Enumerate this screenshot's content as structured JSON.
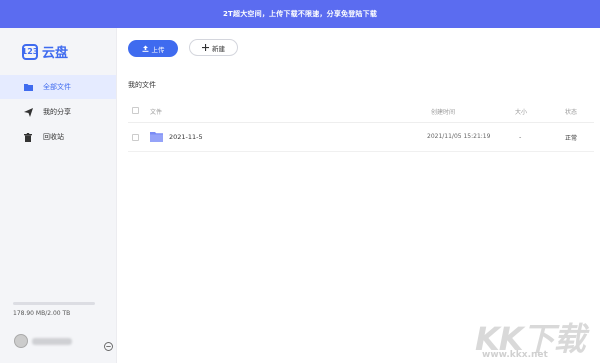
{
  "banner": {
    "text": "2T超大空间，上传下载不限速，分享免登陆下载"
  },
  "brand": {
    "logo_mark": "123",
    "name": "云盘",
    "color": "#3f6bef"
  },
  "sidebar": {
    "items": [
      {
        "label": "全部文件",
        "icon": "folder-icon",
        "active": true
      },
      {
        "label": "我的分享",
        "icon": "send-icon",
        "active": false
      },
      {
        "label": "回收站",
        "icon": "trash-icon",
        "active": false
      }
    ],
    "storage": {
      "text": "178.90 MB/2.00 TB",
      "used_fraction": 0.0001
    }
  },
  "toolbar": {
    "upload_label": "上传",
    "new_label": "新建"
  },
  "breadcrumb": "我的文件",
  "table": {
    "headers": {
      "name": "文件",
      "created": "创建时间",
      "size": "大小",
      "status": "状态"
    },
    "rows": [
      {
        "name": "2021-11-5",
        "created": "2021/11/05 15:21:19",
        "size": "-",
        "status": "正常",
        "type": "folder"
      }
    ]
  },
  "watermark": {
    "brand": "KK下载",
    "url": "www.kkx.net"
  }
}
